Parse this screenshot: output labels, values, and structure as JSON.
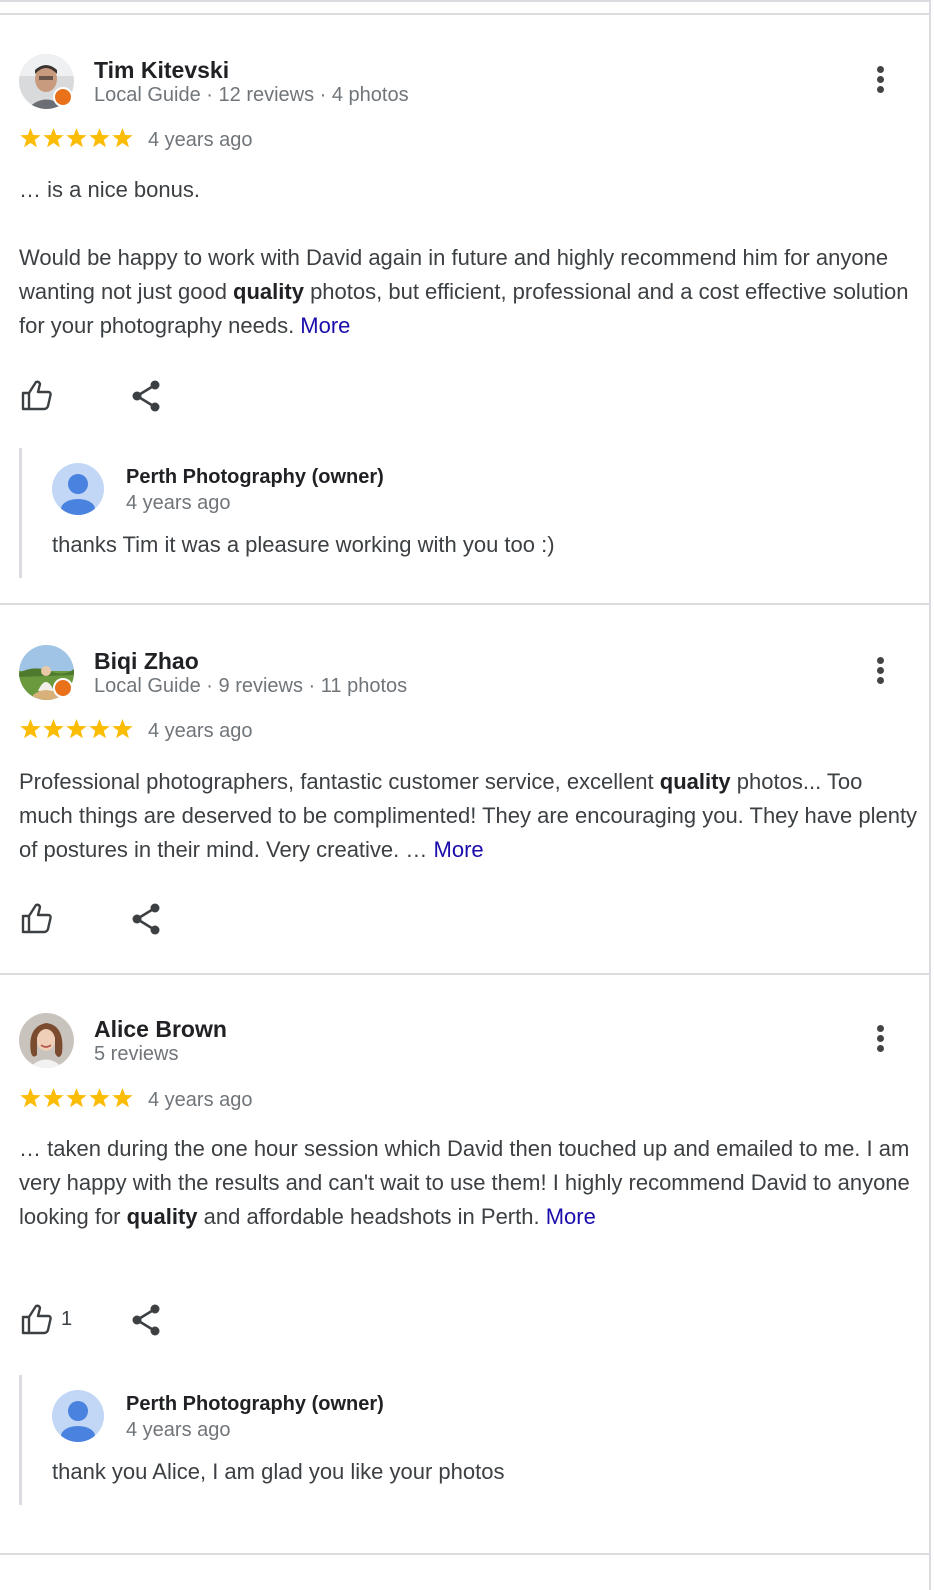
{
  "reviews": [
    {
      "author": "Tim Kitevski",
      "meta": "Local Guide · 12 reviews · 4 photos",
      "rating": 5,
      "time": "4 years ago",
      "text_p1": "… is a nice bonus.",
      "text_p2_a": "Would be happy to work with David again in future and highly recommend him for anyone wanting not just good ",
      "text_p2_bold": "quality",
      "text_p2_b": " photos, but efficient, professional and a cost effective solution for your photography needs. ",
      "more_label": "More",
      "like_count": "",
      "reply": {
        "name": "Perth Photography (owner)",
        "time": "4 years ago",
        "text": "thanks Tim it was a pleasure working with you too :)"
      }
    },
    {
      "author": "Biqi Zhao",
      "meta": "Local Guide · 9 reviews · 11 photos",
      "rating": 5,
      "time": "4 years ago",
      "text_a": "Professional photographers, fantastic customer service, excellent ",
      "text_bold": "quality",
      "text_b": " photos... Too much things are deserved to be complimented! They are encouraging you. They have plenty of postures in their mind. Very creative. … ",
      "more_label": "More",
      "like_count": ""
    },
    {
      "author": "Alice Brown",
      "meta": "5 reviews",
      "rating": 5,
      "time": "4 years ago",
      "text_a": "… taken during the one hour session which David then touched up and emailed to me. I am very happy with the results and can't wait to use them! I highly recommend David to anyone looking for ",
      "text_bold": "quality",
      "text_b": " and affordable headshots in Perth. ",
      "more_label": "More",
      "like_count": "1",
      "reply": {
        "name": "Perth Photography (owner)",
        "time": "4 years ago",
        "text": "thank you Alice, I am glad you like your photos"
      }
    }
  ],
  "colors": {
    "star": "#fbbc04",
    "link": "#1a0dab",
    "local_guide_badge": "#e8711a",
    "owner_avatar_bg": "#c2d7f5",
    "owner_avatar_fg": "#4a82e0"
  },
  "icons": {
    "like": "thumb-up-icon",
    "share": "share-icon",
    "menu": "more-vert-icon"
  }
}
